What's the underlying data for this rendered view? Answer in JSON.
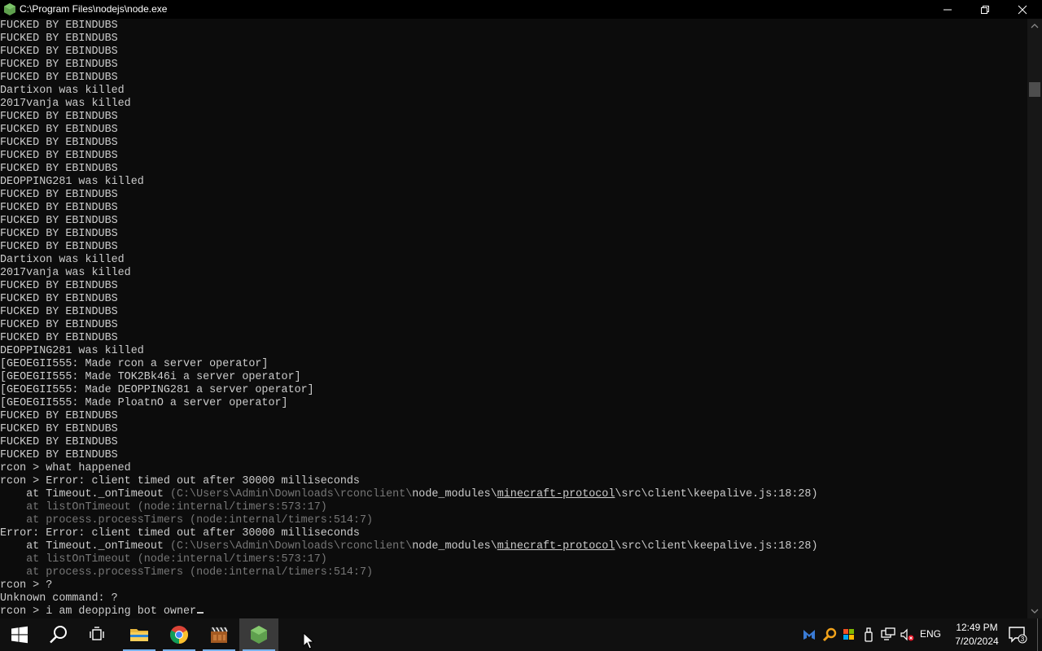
{
  "window": {
    "title": "C:\\Program Files\\nodejs\\node.exe"
  },
  "console": {
    "lines": [
      {
        "t": "FUCKED BY EBINDUBS"
      },
      {
        "t": "FUCKED BY EBINDUBS"
      },
      {
        "t": "FUCKED BY EBINDUBS"
      },
      {
        "t": "FUCKED BY EBINDUBS"
      },
      {
        "t": "FUCKED BY EBINDUBS"
      },
      {
        "t": "Dartixon was killed"
      },
      {
        "t": "2017vanja was killed"
      },
      {
        "t": "FUCKED BY EBINDUBS"
      },
      {
        "t": "FUCKED BY EBINDUBS"
      },
      {
        "t": "FUCKED BY EBINDUBS"
      },
      {
        "t": "FUCKED BY EBINDUBS"
      },
      {
        "t": "FUCKED BY EBINDUBS"
      },
      {
        "t": "DEOPPING281 was killed"
      },
      {
        "t": "FUCKED BY EBINDUBS"
      },
      {
        "t": "FUCKED BY EBINDUBS"
      },
      {
        "t": "FUCKED BY EBINDUBS"
      },
      {
        "t": "FUCKED BY EBINDUBS"
      },
      {
        "t": "FUCKED BY EBINDUBS"
      },
      {
        "t": "Dartixon was killed"
      },
      {
        "t": "2017vanja was killed"
      },
      {
        "t": "FUCKED BY EBINDUBS"
      },
      {
        "t": "FUCKED BY EBINDUBS"
      },
      {
        "t": "FUCKED BY EBINDUBS"
      },
      {
        "t": "FUCKED BY EBINDUBS"
      },
      {
        "t": "FUCKED BY EBINDUBS"
      },
      {
        "t": "DEOPPING281 was killed"
      },
      {
        "t": "[GEOEGII555: Made rcon a server operator]"
      },
      {
        "t": "[GEOEGII555: Made TOK2Bk46i a server operator]"
      },
      {
        "t": "[GEOEGII555: Made DEOPPING281 a server operator]"
      },
      {
        "t": "[GEOEGII555: Made PloatnO a server operator]"
      },
      {
        "t": "FUCKED BY EBINDUBS"
      },
      {
        "t": "FUCKED BY EBINDUBS"
      },
      {
        "t": "FUCKED BY EBINDUBS"
      },
      {
        "t": "FUCKED BY EBINDUBS"
      },
      {
        "t": "rcon > what happened"
      },
      {
        "t": "rcon > Error: client timed out after 30000 milliseconds"
      },
      {
        "t": "    at Timeout._onTimeout ",
        "dim": "(C:\\Users\\Admin\\Downloads\\rconclient\\",
        "t2": "node_modules\\",
        "u": "minecraft-protocol",
        "t3": "\\src\\client\\keepalive.js:18:28)"
      },
      {
        "dimline": "    at listOnTimeout (node:internal/timers:573:17)"
      },
      {
        "dimline": "    at process.processTimers (node:internal/timers:514:7)"
      },
      {
        "t": "Error: Error: client timed out after 30000 milliseconds"
      },
      {
        "t": "    at Timeout._onTimeout ",
        "dim": "(C:\\Users\\Admin\\Downloads\\rconclient\\",
        "t2": "node_modules\\",
        "u": "minecraft-protocol",
        "t3": "\\src\\client\\keepalive.js:18:28)"
      },
      {
        "dimline": "    at listOnTimeout (node:internal/timers:573:17)"
      },
      {
        "dimline": "    at process.processTimers (node:internal/timers:514:7)"
      },
      {
        "t": "rcon > ?"
      },
      {
        "t": "Unknown command: ?"
      },
      {
        "t": "rcon > i am deopping bot owner",
        "cursor": true
      }
    ]
  },
  "taskbar": {
    "items": [
      {
        "name": "start-button",
        "icon": "windows-logo-icon"
      },
      {
        "name": "search-button",
        "icon": "search-icon"
      },
      {
        "name": "task-view-button",
        "icon": "task-view-icon"
      },
      {
        "name": "file-explorer-app",
        "icon": "folder-icon"
      },
      {
        "name": "chrome-app",
        "icon": "chrome-icon"
      },
      {
        "name": "clapper-app",
        "icon": "clapperboard-icon"
      },
      {
        "name": "nodejs-app",
        "icon": "nodejs-icon",
        "active": true
      }
    ],
    "tray": {
      "language": "ENG",
      "time": "12:49 PM",
      "date": "7/20/2024",
      "notification_count": "3"
    }
  }
}
